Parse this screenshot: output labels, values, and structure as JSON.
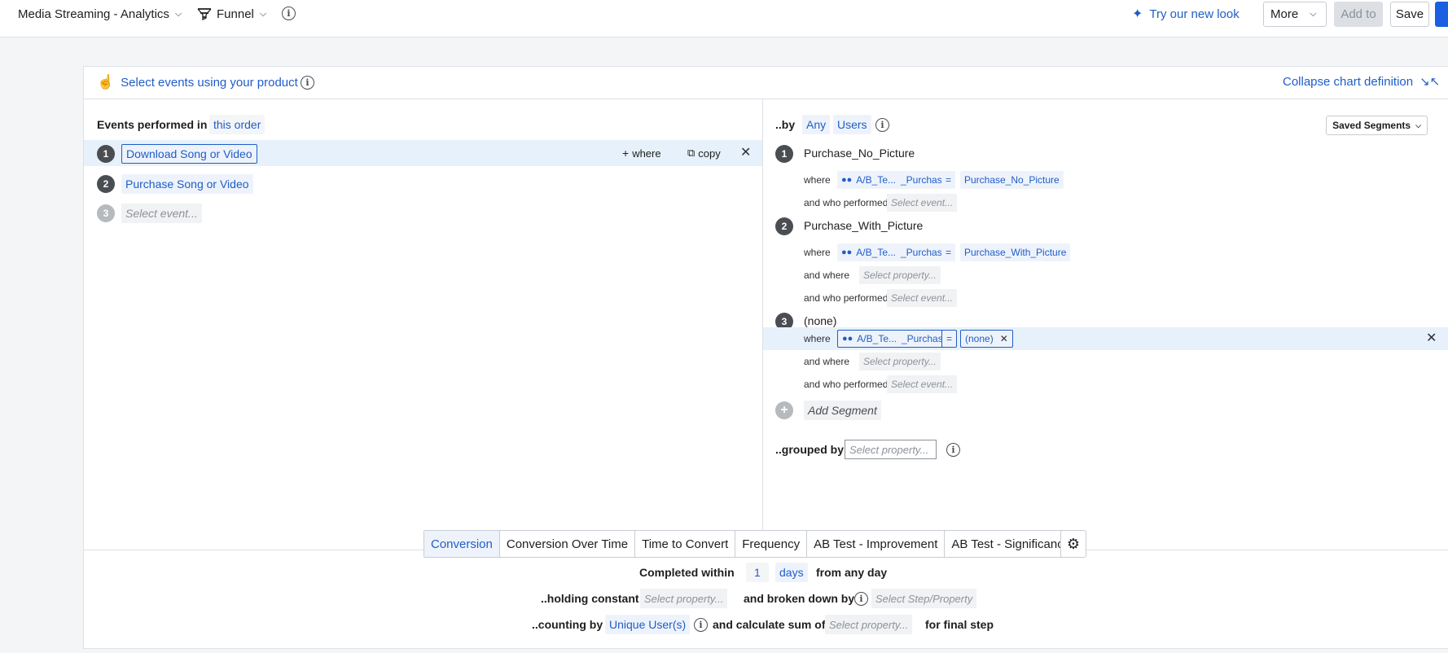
{
  "topbar": {
    "project": "Media Streaming - Analytics",
    "chart_type": "Funnel",
    "try_new_look": "Try our new look",
    "more": "More",
    "add_to": "Add to",
    "save": "Save"
  },
  "header": {
    "select_events": "Select events using your product",
    "collapse": "Collapse chart definition"
  },
  "events": {
    "performed_in": "Events performed in",
    "order": "this order",
    "where": "where",
    "copy": "copy",
    "steps": [
      {
        "num": "1",
        "label": "Download Song or Video"
      },
      {
        "num": "2",
        "label": "Purchase Song or Video"
      },
      {
        "num": "3",
        "placeholder": "Select event..."
      }
    ]
  },
  "segments": {
    "by": "..by",
    "any": "Any",
    "users": "Users",
    "saved_segments": "Saved Segments",
    "items": [
      {
        "num": "1",
        "name": "Purchase_No_Picture",
        "where": "where",
        "property": "A/B_Te...",
        "property_suffix": "_Purchase",
        "op": "=",
        "value": "Purchase_No_Picture",
        "who_performed": "and who performed",
        "event_placeholder": "Select event..."
      },
      {
        "num": "2",
        "name": "Purchase_With_Picture",
        "where": "where",
        "property": "A/B_Te...",
        "property_suffix": "_Purchase",
        "op": "=",
        "value": "Purchase_With_Picture",
        "and_where": "and where",
        "property_placeholder": "Select property...",
        "who_performed": "and who performed",
        "event_placeholder": "Select event..."
      },
      {
        "num": "3",
        "name": "(none)",
        "where": "where",
        "property": "A/B_Te...",
        "property_suffix": "_Purchase",
        "op": "=",
        "value": "(none)",
        "and_where": "and where",
        "property_placeholder": "Select property...",
        "who_performed": "and who performed",
        "event_placeholder": "Select event..."
      }
    ],
    "add_segment": "Add Segment",
    "grouped_by": "..grouped by",
    "grouped_placeholder": "Select property..."
  },
  "tabs": [
    "Conversion",
    "Conversion Over Time",
    "Time to Convert",
    "Frequency",
    "AB Test - Improvement",
    "AB Test - Significance"
  ],
  "active_tab": "Conversion",
  "settings": {
    "completed_within": "Completed within",
    "days_value": "1",
    "days_unit": "days",
    "from_any_day": "from any day",
    "holding_constant": "..holding constant",
    "holding_placeholder": "Select property...",
    "broken_down_by": "and broken down by",
    "broken_placeholder": "Select Step/Property",
    "counting_by": "..counting by",
    "counting_value": "Unique User(s)",
    "calc_sum": "and calculate sum of",
    "calc_placeholder": "Select property...",
    "final_step": "for final step"
  }
}
